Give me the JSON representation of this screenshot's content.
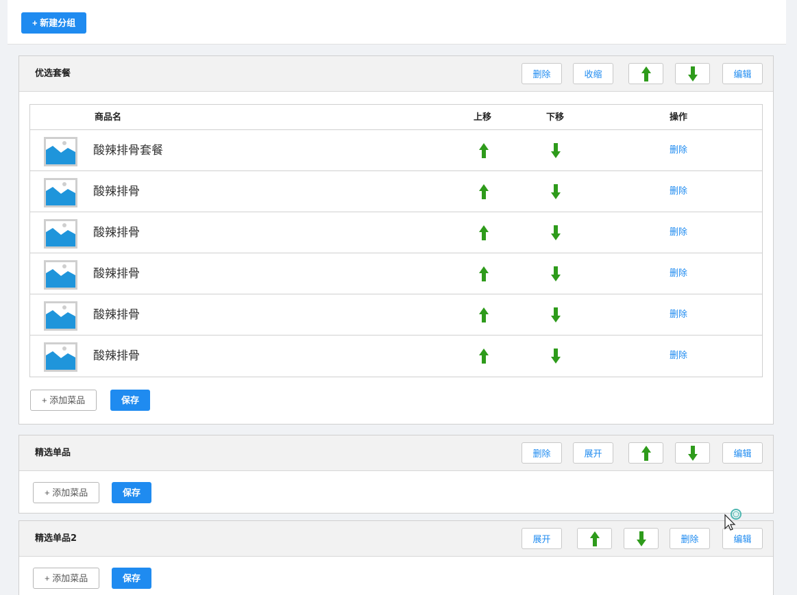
{
  "toolbar": {
    "new_group_label": "+ 新建分组"
  },
  "groups": [
    {
      "title": "优选套餐",
      "delete_label": "删除",
      "toggle_label": "收缩",
      "edit_label": "编辑",
      "table": {
        "headers": {
          "name": "商品名",
          "up": "上移",
          "down": "下移",
          "action": "操作"
        },
        "rows": [
          {
            "name": "酸辣排骨套餐",
            "delete": "删除"
          },
          {
            "name": "酸辣排骨",
            "delete": "删除"
          },
          {
            "name": "酸辣排骨",
            "delete": "删除"
          },
          {
            "name": "酸辣排骨",
            "delete": "删除"
          },
          {
            "name": "酸辣排骨",
            "delete": "删除"
          },
          {
            "name": "酸辣排骨",
            "delete": "删除"
          }
        ]
      },
      "add_label": "+ 添加菜品",
      "save_label": "保存"
    },
    {
      "title": "精选单品",
      "delete_label": "删除",
      "toggle_label": "展开",
      "edit_label": "编辑",
      "add_label": "+ 添加菜品",
      "save_label": "保存"
    },
    {
      "title": "精选单品2",
      "toggle_label": "展开",
      "delete_label": "删除",
      "edit_label": "编辑",
      "add_label": "+ 添加菜品",
      "save_label": "保存"
    }
  ],
  "icons": {
    "up": "arrow-up-icon",
    "down": "arrow-down-icon",
    "thumb": "image-placeholder-icon"
  },
  "colors": {
    "primary": "#1f8bf0",
    "arrow": "#2e9b1b"
  }
}
